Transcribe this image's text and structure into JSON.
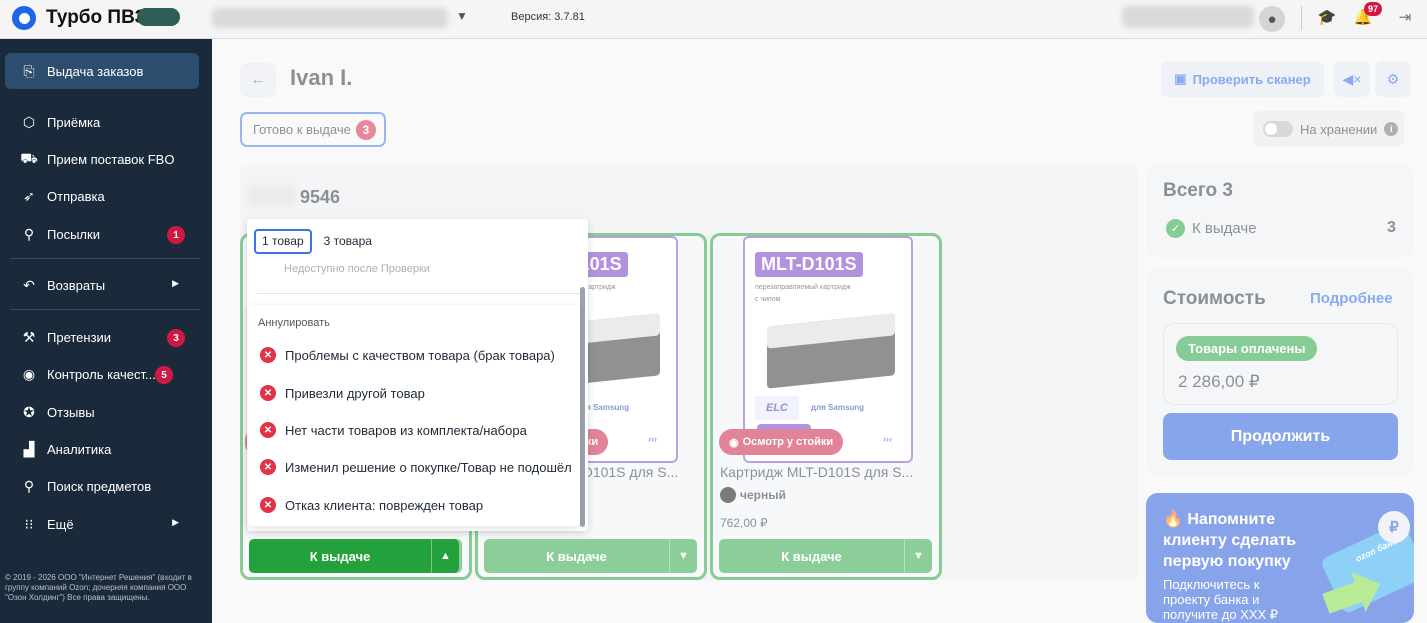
{
  "app": {
    "brand": "Турбо ПВЗ",
    "version": "Версия: 3.7.81",
    "notif_count": "97"
  },
  "sidebar": {
    "items": [
      {
        "label": "Выдача заказов",
        "icon": "package-out-icon"
      },
      {
        "label": "Приёмка",
        "icon": "box-icon"
      },
      {
        "label": "Прием поставок FBO",
        "icon": "truck-icon"
      },
      {
        "label": "Отправка",
        "icon": "send-icon"
      },
      {
        "label": "Посылки",
        "icon": "person-icon",
        "badge": "1"
      },
      {
        "label": "Возвраты",
        "icon": "return-icon"
      },
      {
        "label": "Претензии",
        "icon": "gavel-icon",
        "badge": "3"
      },
      {
        "label": "Контроль качест...",
        "icon": "eye-icon",
        "badge": "5"
      },
      {
        "label": "Отзывы",
        "icon": "star-chat-icon"
      },
      {
        "label": "Аналитика",
        "icon": "analytics-icon"
      },
      {
        "label": "Поиск предметов",
        "icon": "search-icon"
      },
      {
        "label": "Ещё",
        "icon": "grid-icon"
      }
    ],
    "copyright": "© 2019 - 2026 ООО \"Интернет Решения\" (входит в группу компаний Ozon; дочерняя компания ООО \"Озон Холдинг\") Все права защищены."
  },
  "header": {
    "title": "Ivan I.",
    "chip_label": "Готово к выдаче",
    "chip_count": "3",
    "scanner_label": "Проверить сканер",
    "storage_label": "На хранении"
  },
  "order": {
    "number": "9546"
  },
  "cards": [
    {
      "name": "Картридж MLT-D101S для S...",
      "image_title": "MLT-D101S",
      "image_sub1": "перезаправляемый картридж",
      "image_sub2": "с чипом",
      "image_brand": "ELC",
      "image_for": "для Samsung",
      "inspect": "Осмотр у стойки",
      "color": "черный",
      "price": "762,00 ₽",
      "button": "К выдаче"
    }
  ],
  "dropdown": {
    "qty_options": [
      "1 товар",
      "3 товара"
    ],
    "note": "Недоступно после Проверки",
    "reasons_header": "Аннулировать",
    "reasons": [
      "Проблемы с качеством товара (брак товара)",
      "Привезли другой товар",
      "Нет части товаров из комплекта/набора",
      "Изменил решение о покупке/Товар не подошёл",
      "Отказ клиента: поврежден товар"
    ]
  },
  "summary": {
    "total_label": "Всего 3",
    "ready_label": "К выдаче",
    "ready_count": "3",
    "cost_label": "Стоимость",
    "more_label": "Подробнее",
    "paid_label": "Товары оплачены",
    "sum": "2 286,00 ₽",
    "continue_label": "Продолжить"
  },
  "promo": {
    "heading": "🔥 Напомните клиенту сделать первую покупку",
    "text": "Подключитесь к проекту банка и получите до XXX ₽",
    "card_brand": "ozon банк",
    "coin": "₽"
  },
  "colors": {
    "accent": "#1f5ae6",
    "sidebar": "#1b2a3a",
    "green": "#22a13d",
    "badge": "#d01942"
  }
}
